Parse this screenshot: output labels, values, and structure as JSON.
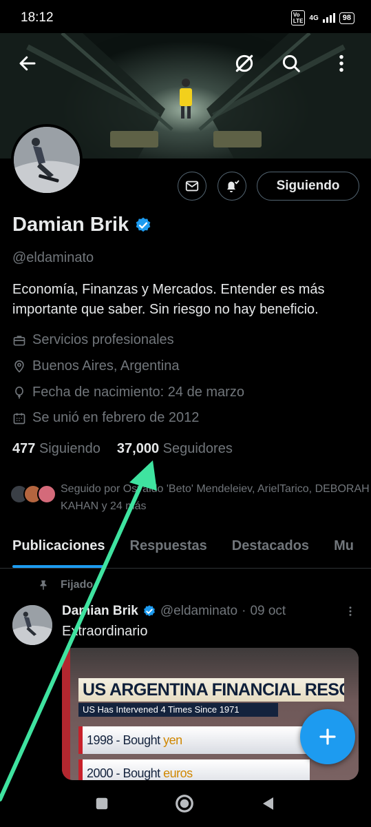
{
  "status_bar": {
    "time": "18:12",
    "volte": "Vo LTE",
    "network": "4G",
    "battery": "98"
  },
  "header": {
    "back_icon": "arrow-left-icon",
    "grok_icon": "grok-icon",
    "search_icon": "search-icon",
    "more_icon": "more-vertical-icon"
  },
  "profile": {
    "display_name": "Damian Brik",
    "verified": true,
    "handle": "@eldaminato",
    "bio": "Economía, Finanzas y Mercados. Entender es más importante que saber. Sin riesgo no hay beneficio.",
    "category": "Servicios profesionales",
    "location": "Buenos Aires, Argentina",
    "birthday": "Fecha de nacimiento: 24 de marzo",
    "joined": "Se unió en febrero de 2012",
    "following_count": "477",
    "following_label": "Siguiendo",
    "followers_count": "37,000",
    "followers_label": "Seguidores",
    "followed_by": "Seguido por Osvaldo 'Beto' Mendeleiev, ArielTarico, DEBORAH KAHAN y 24 más"
  },
  "actions": {
    "message_icon": "mail-icon",
    "notify_icon": "bell-check-icon",
    "following_button": "Siguiendo"
  },
  "tabs": [
    {
      "label": "Publicaciones",
      "active": true
    },
    {
      "label": "Respuestas",
      "active": false
    },
    {
      "label": "Destacados",
      "active": false
    },
    {
      "label": "Mu",
      "active": false
    }
  ],
  "pinned_post": {
    "pinned_label": "Fijado",
    "author_name": "Damian Brik",
    "author_handle": "@eldaminato",
    "separator": "·",
    "date": "09 oct",
    "text": "Extraordinario",
    "media": {
      "headline": "US ARGENTINA FINANCIAL RESCUE",
      "subheadline": "US Has Intervened 4 Times Since 1971",
      "rows": [
        {
          "prefix": "1998 - Bought ",
          "highlight": "yen"
        },
        {
          "prefix": "2000 - Bought ",
          "highlight": "euros"
        }
      ]
    }
  },
  "fab": {
    "icon": "plus-icon"
  },
  "nav_bar": {
    "recents_icon": "square-icon",
    "home_icon": "circle-icon",
    "back_icon": "triangle-back-icon"
  },
  "colors": {
    "accent": "#1d9bf0",
    "annotation_arrow": "#3fe3a0",
    "text_primary": "#e7e9ea",
    "text_secondary": "#71767b"
  }
}
